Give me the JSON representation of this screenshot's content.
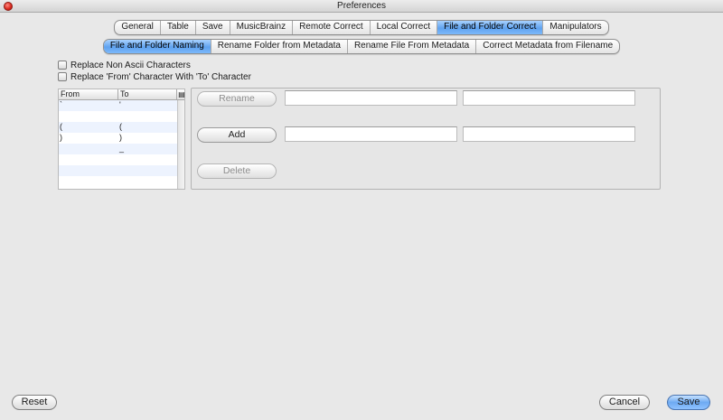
{
  "window": {
    "title": "Preferences"
  },
  "main_tabs": [
    {
      "label": "General"
    },
    {
      "label": "Table"
    },
    {
      "label": "Save"
    },
    {
      "label": "MusicBrainz"
    },
    {
      "label": "Remote Correct"
    },
    {
      "label": "Local Correct"
    },
    {
      "label": "File and Folder Correct",
      "active": true
    },
    {
      "label": "Manipulators"
    }
  ],
  "sub_tabs": [
    {
      "label": "File and Folder Naming",
      "active": true
    },
    {
      "label": "Rename Folder from Metadata"
    },
    {
      "label": "Rename File From Metadata"
    },
    {
      "label": "Correct Metadata from Filename"
    }
  ],
  "options": {
    "replace_non_ascii": {
      "label": "Replace Non Ascii Characters",
      "checked": false
    },
    "replace_from_to": {
      "label": "Replace 'From' Character With 'To' Character",
      "checked": false
    }
  },
  "table": {
    "headers": {
      "from": "From",
      "to": "To"
    },
    "rows": [
      {
        "from": "`",
        "to": "'"
      },
      {
        "from": "",
        "to": ""
      },
      {
        "from": "(",
        "to": "("
      },
      {
        "from": ")",
        "to": ")"
      },
      {
        "from": "",
        "to": "_"
      },
      {
        "from": "",
        "to": ""
      },
      {
        "from": "",
        "to": ""
      },
      {
        "from": "",
        "to": ""
      }
    ]
  },
  "editor": {
    "rename_label": "Rename",
    "add_label": "Add",
    "delete_label": "Delete"
  },
  "footer": {
    "reset_label": "Reset",
    "cancel_label": "Cancel",
    "save_label": "Save"
  },
  "colors": {
    "accent": "#6eaaf2"
  }
}
